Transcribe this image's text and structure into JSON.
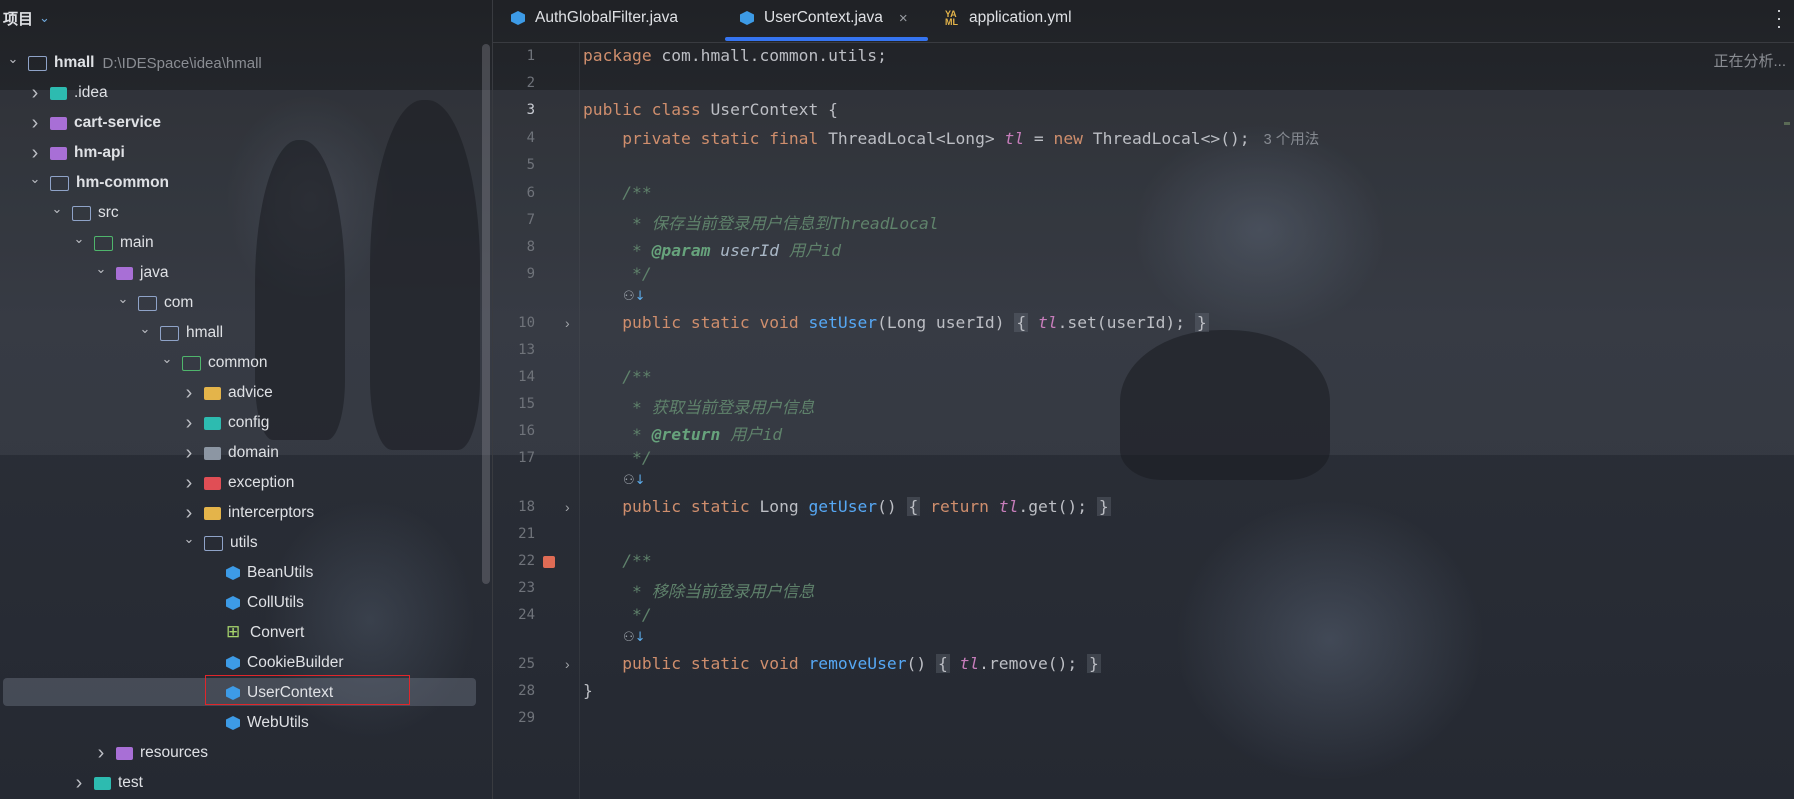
{
  "sidebar": {
    "title": "项目",
    "tree": [
      {
        "label": "hmall",
        "path": "D:\\IDESpace\\idea\\hmall",
        "bold": true,
        "level": 0,
        "arrow": "down",
        "icon": "folder-icon",
        "cls": "folder"
      },
      {
        "label": ".idea",
        "level": 1,
        "arrow": "right",
        "icon": "idea-folder-icon",
        "cls": "folder-teal"
      },
      {
        "label": "cart-service",
        "bold": true,
        "level": 1,
        "arrow": "right",
        "icon": "module-folder-icon",
        "cls": "folder-purple"
      },
      {
        "label": "hm-api",
        "bold": true,
        "level": 1,
        "arrow": "right",
        "icon": "module-folder-icon",
        "cls": "folder-purple"
      },
      {
        "label": "hm-common",
        "bold": true,
        "level": 1,
        "arrow": "down",
        "icon": "folder-icon",
        "cls": "folder"
      },
      {
        "label": "src",
        "level": 2,
        "arrow": "down",
        "icon": "source-folder-icon",
        "cls": "folder"
      },
      {
        "label": "main",
        "level": 3,
        "arrow": "down",
        "icon": "source-root-icon",
        "cls": "folder-green"
      },
      {
        "label": "java",
        "level": 4,
        "arrow": "down",
        "icon": "java-source-folder-icon",
        "cls": "folder-purple"
      },
      {
        "label": "com",
        "level": 5,
        "arrow": "down",
        "icon": "package-folder-icon",
        "cls": "folder"
      },
      {
        "label": "hmall",
        "level": 6,
        "arrow": "down",
        "icon": "package-folder-icon",
        "cls": "folder"
      },
      {
        "label": "common",
        "level": 7,
        "arrow": "down",
        "icon": "package-folder-icon",
        "cls": "folder-green"
      },
      {
        "label": "advice",
        "level": 8,
        "arrow": "right",
        "icon": "package-folder-icon",
        "cls": "folder-yellow"
      },
      {
        "label": "config",
        "level": 8,
        "arrow": "right",
        "icon": "config-folder-icon",
        "cls": "folder-teal"
      },
      {
        "label": "domain",
        "level": 8,
        "arrow": "right",
        "icon": "domain-folder-icon",
        "cls": "folder-gray"
      },
      {
        "label": "exception",
        "level": 8,
        "arrow": "right",
        "icon": "exception-folder-icon",
        "cls": "folder-red"
      },
      {
        "label": "intercerptors",
        "level": 8,
        "arrow": "right",
        "icon": "package-folder-icon",
        "cls": "folder-yellow"
      },
      {
        "label": "utils",
        "level": 8,
        "arrow": "down",
        "icon": "package-folder-icon",
        "cls": "folder"
      },
      {
        "label": "BeanUtils",
        "level": 9,
        "arrow": "",
        "icon": "java-class-icon",
        "cls": "java-cube"
      },
      {
        "label": "CollUtils",
        "level": 9,
        "arrow": "",
        "icon": "java-class-icon",
        "cls": "java-cube"
      },
      {
        "label": "Convert",
        "level": 9,
        "arrow": "",
        "icon": "interface-icon",
        "cls": "convert-ico"
      },
      {
        "label": "CookieBuilder",
        "level": 9,
        "arrow": "",
        "icon": "java-class-icon",
        "cls": "java-cube"
      },
      {
        "label": "UserContext",
        "level": 9,
        "arrow": "",
        "icon": "java-class-icon",
        "cls": "java-cube"
      },
      {
        "label": "WebUtils",
        "level": 9,
        "arrow": "",
        "icon": "java-class-icon",
        "cls": "java-cube"
      },
      {
        "label": "resources",
        "level": 4,
        "arrow": "right",
        "icon": "resources-folder-icon",
        "cls": "folder-purple"
      },
      {
        "label": "test",
        "level": 3,
        "arrow": "right",
        "icon": "test-folder-icon",
        "cls": "folder-teal"
      }
    ]
  },
  "tabs": [
    {
      "label": "AuthGlobalFilter.java",
      "icon": "java-class-icon",
      "active": false
    },
    {
      "label": "UserContext.java",
      "icon": "java-class-icon",
      "active": true,
      "close": "×"
    },
    {
      "label": "application.yml",
      "icon": "yaml-file-icon",
      "active": false
    }
  ],
  "editor": {
    "status": "正在分析...",
    "inlay_hint": "3 个用法",
    "line_numbers": [
      "1",
      "2",
      "3",
      "4",
      "5",
      "6",
      "7",
      "8",
      "9",
      "10",
      "13",
      "14",
      "15",
      "16",
      "17",
      "18",
      "21",
      "22",
      "23",
      "24",
      "25",
      "28",
      "29"
    ],
    "code": {
      "pkg": "package",
      "pkg_name": " com.hmall.common.utils;",
      "public": "public",
      "class": "class",
      "class_name": " UserContext {",
      "private_static_final": "private static final",
      "threadlocal_type": " ThreadLocal<Long> ",
      "tl": "tl",
      "assign": " = ",
      "new": "new",
      "threadlocal_init": " ThreadLocal<>();",
      "doc_open": "/**",
      "doc_set": " * 保存当前登录用户信息到ThreadLocal",
      "param_tag": "@param",
      "param_name": "userId",
      "param_desc": "用户id",
      "doc_close": " */",
      "public_static_void": "public static void",
      "set_user": "setUser",
      "set_params": "(Long userId)",
      "brace_open": "{",
      "brace_close": "}",
      "set_body": ".set(userId);",
      "doc_get": " * 获取当前登录用户信息",
      "return_tag": "@return",
      "return_desc": "用户id",
      "public_static": "public static",
      "long_type": " Long ",
      "get_user": "getUser",
      "empty_params": "()",
      "return_kw": "return",
      "get_body": ".get();",
      "doc_remove": " * 移除当前登录用户信息",
      "remove_user": "removeUser",
      "remove_body": ".remove();",
      "class_close": "}"
    }
  },
  "colors": {
    "accent": "#3574f0",
    "highlight_box": "#e0262b",
    "keyword": "#cf8e6d",
    "function": "#56a8f5",
    "field": "#c77dbb",
    "comment": "#5f826b"
  }
}
